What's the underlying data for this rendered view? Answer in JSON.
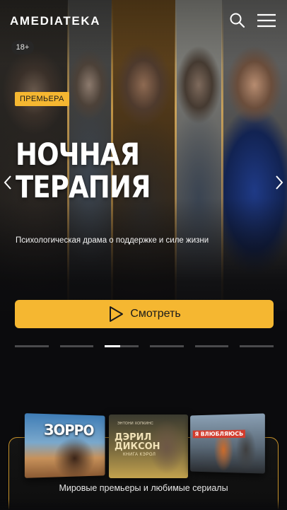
{
  "header": {
    "logo_text": "AMEDIATEKA",
    "search_icon": "search-icon",
    "menu_icon": "hamburger-menu-icon"
  },
  "hero": {
    "age_rating": "18+",
    "badge": "ПРЕМЬЕРА",
    "title_line1": "НОЧНАЯ",
    "title_line2": "ТЕРАПИЯ",
    "tagline": "Психологическая драма о поддержке и силе жизни",
    "watch_label": "Смотреть",
    "prev_icon": "chevron-left-icon",
    "next_icon": "chevron-right-icon",
    "play_icon": "play-icon",
    "slides_count": 6,
    "active_slide_index": 2,
    "active_slide_progress": 0.45
  },
  "promo": {
    "caption": "Мировые премьеры и любимые сериалы",
    "posters": [
      {
        "title": "ЗОРРО"
      },
      {
        "top": "ЭНТОНИ ХОПКИНС",
        "title": "ДЭРИЛ\nДИКСОН",
        "subtitle": "КНИГА КЭРОЛ"
      },
      {
        "title": "Я ВЛЮБЛЯЮСЬ"
      }
    ]
  },
  "colors": {
    "accent": "#f5b731",
    "background": "#0b0b0d",
    "frame_border": "#c8922a"
  }
}
